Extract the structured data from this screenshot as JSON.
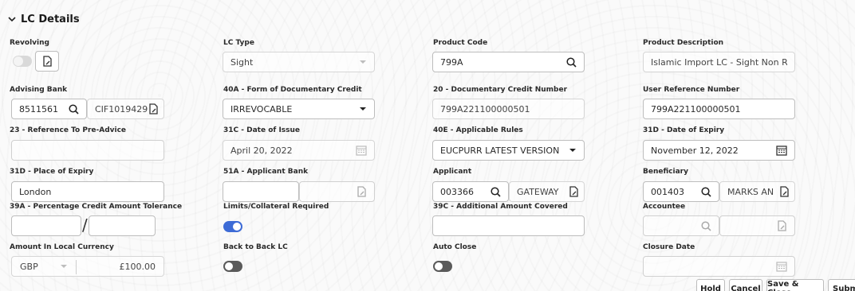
{
  "section": {
    "title": "LC Details"
  },
  "fields": {
    "revolving": {
      "label": "Revolving"
    },
    "lc_type": {
      "label": "LC Type",
      "value": "Sight"
    },
    "product_code": {
      "label": "Product Code",
      "value": "799A"
    },
    "product_description": {
      "label": "Product Description",
      "value": "Islamic Import LC - Sight Non Revolv"
    },
    "advising_bank": {
      "label": "Advising Bank",
      "code": "8511561",
      "name": "CIF1019429"
    },
    "form_of_credit": {
      "label": "40A - Form of Documentary Credit",
      "value": "IRREVOCABLE"
    },
    "doc_credit_number": {
      "label": "20 - Documentary Credit Number",
      "value": "799A221100000501"
    },
    "user_reference": {
      "label": "User Reference Number",
      "value": "799A221100000501"
    },
    "ref_pre_advice": {
      "label": "23 - Reference To Pre-Advice",
      "value": ""
    },
    "date_of_issue": {
      "label": "31C - Date of Issue",
      "value": "April 20, 2022"
    },
    "applicable_rules": {
      "label": "40E - Applicable Rules",
      "value": "EUCPURR LATEST VERSION"
    },
    "date_of_expiry": {
      "label": "31D - Date of Expiry",
      "value": "November 12, 2022"
    },
    "place_of_expiry": {
      "label": "31D - Place of Expiry",
      "value": "London"
    },
    "applicant_bank": {
      "label": "51A - Applicant Bank",
      "value": ""
    },
    "applicant": {
      "label": "Applicant",
      "code": "003366",
      "name": "GATEWAY"
    },
    "beneficiary": {
      "label": "Beneficiary",
      "code": "001403",
      "name": "MARKS AN"
    },
    "pct_tolerance": {
      "label": "39A - Percentage Credit Amount Tolerance",
      "separator": "/"
    },
    "limits_required": {
      "label": "Limits/Collateral Required"
    },
    "additional_amount": {
      "label": "39C - Additional Amount Covered",
      "value": ""
    },
    "accountee": {
      "label": "Accountee"
    },
    "amount_local": {
      "label": "Amount In Local Currency",
      "currency": "GBP",
      "amount": "£100.00"
    },
    "back_to_back": {
      "label": "Back to Back LC"
    },
    "auto_close": {
      "label": "Auto Close"
    },
    "closure_date": {
      "label": "Closure Date",
      "value": ""
    }
  },
  "footer": {
    "hold": "Hold",
    "cancel": "Cancel",
    "save_close": "Save & Close",
    "submit": "Submi"
  },
  "icons": {
    "search": "search-icon",
    "lookup": "lookup-icon",
    "calendar": "calendar-icon",
    "dropdown": "chevron-down-icon"
  },
  "colors": {
    "toggle_on": "#3d6bd6",
    "toggle_off_dark": "#5a5a5a"
  }
}
